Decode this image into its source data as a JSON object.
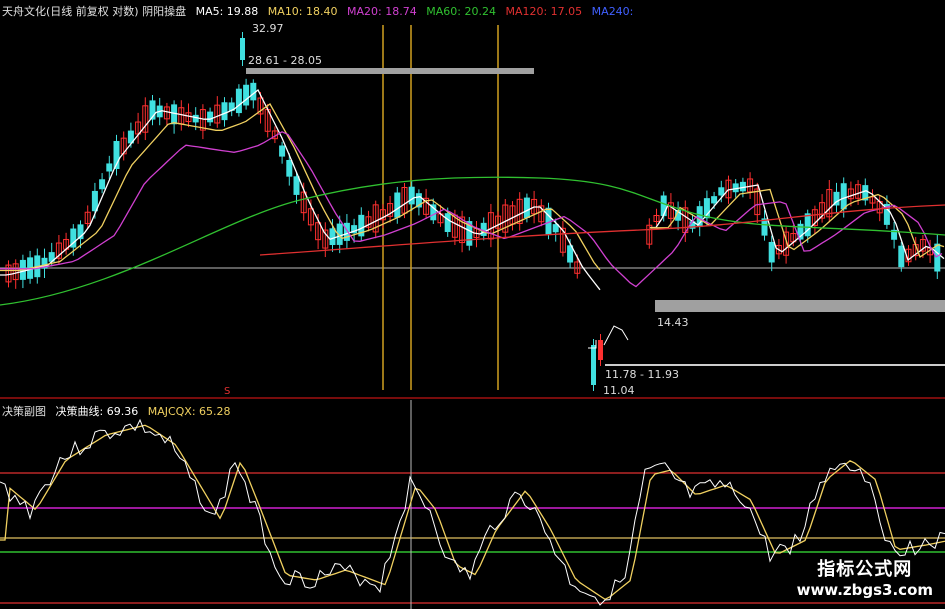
{
  "header": {
    "title": "天舟文化(日线 前复权 对数) 阴阳操盘",
    "ma_items": [
      {
        "label": "MA5: 19.88",
        "color": "#ffffff"
      },
      {
        "label": "MA10: 18.40",
        "color": "#f0d060"
      },
      {
        "label": "MA20: 18.74",
        "color": "#d040d0"
      },
      {
        "label": "MA60: 20.24",
        "color": "#30c030"
      },
      {
        "label": "MA120: 17.05",
        "color": "#e03030"
      },
      {
        "label": "MA240:",
        "color": "#4060ff"
      }
    ]
  },
  "price_labels": {
    "high": "32.97",
    "upper_band": "28.61 - 28.05",
    "mid_band": "14.43",
    "lower_band": "11.78 - 11.93",
    "low": "11.04",
    "marker": "S"
  },
  "indicator_header": {
    "title": "决策副图",
    "curve": "决策曲线: 69.36",
    "majcqx": "MAJCQX: 65.28"
  },
  "watermark": {
    "title": "指标公式网",
    "url": "www.zbgs3.com"
  },
  "colors": {
    "bull": "#ff3030",
    "bear": "#40e0e0",
    "ma5": "#ffffff",
    "ma10": "#f0d060",
    "ma20": "#d040d0",
    "ma60": "#30c030",
    "ma120": "#e03030",
    "band": "#a0a0a0",
    "level_red": "#e03030",
    "level_purple": "#d020d0",
    "level_yellow": "#e0c060",
    "level_green": "#30c030"
  }
}
